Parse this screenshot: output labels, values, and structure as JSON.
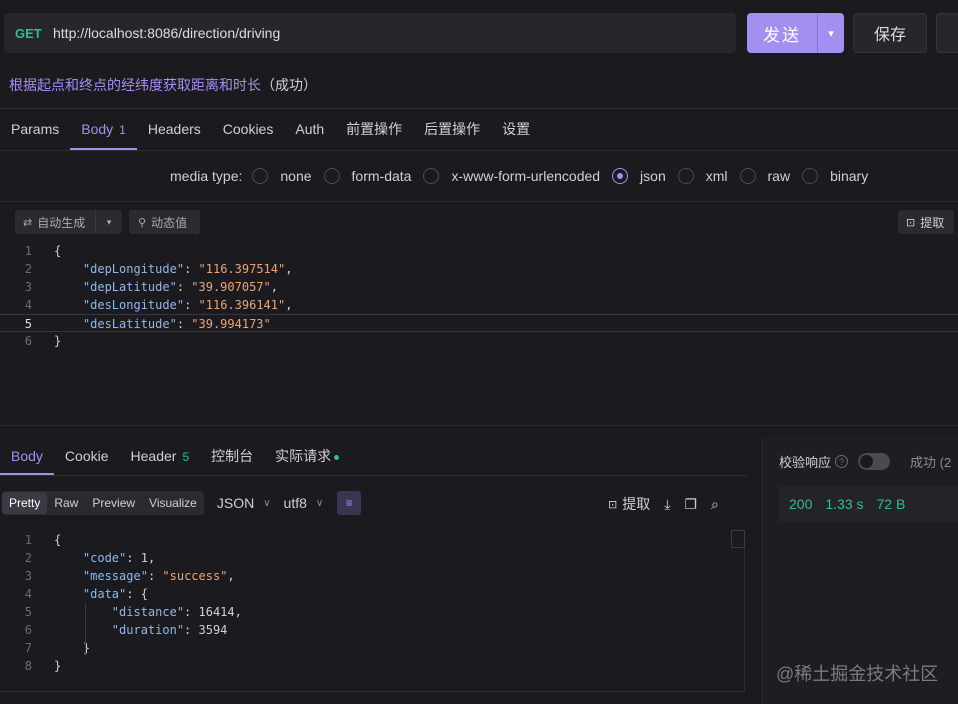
{
  "request": {
    "method": "GET",
    "url": "http://localhost:8086/direction/driving",
    "send_label": "发送",
    "save_label": "保存",
    "description": "根据起点和终点的经纬度获取距离和时长",
    "status_label": "（成功）"
  },
  "request_tabs": [
    {
      "label": "Params"
    },
    {
      "label": "Body",
      "count": "1"
    },
    {
      "label": "Headers"
    },
    {
      "label": "Cookies"
    },
    {
      "label": "Auth"
    },
    {
      "label": "前置操作"
    },
    {
      "label": "后置操作"
    },
    {
      "label": "设置"
    }
  ],
  "media": {
    "label": "media type:",
    "options": [
      "none",
      "form-data",
      "x-www-form-urlencoded",
      "json",
      "xml",
      "raw",
      "binary"
    ],
    "selected": "json"
  },
  "editor_toolbar": {
    "auto_generate": "自动生成",
    "dynamic_value": "动态值",
    "extract": "提取"
  },
  "request_body": [
    {
      "n": "1",
      "parts": [
        [
          "n",
          "{"
        ]
      ]
    },
    {
      "n": "2",
      "parts": [
        [
          "n",
          "    "
        ],
        [
          "k",
          "\"depLongitude\""
        ],
        [
          "n",
          ": "
        ],
        [
          "s",
          "\"116.397514\""
        ],
        [
          "n",
          ","
        ]
      ]
    },
    {
      "n": "3",
      "parts": [
        [
          "n",
          "    "
        ],
        [
          "k",
          "\"depLatitude\""
        ],
        [
          "n",
          ": "
        ],
        [
          "s",
          "\"39.907057\""
        ],
        [
          "n",
          ","
        ]
      ]
    },
    {
      "n": "4",
      "parts": [
        [
          "n",
          "    "
        ],
        [
          "k",
          "\"desLongitude\""
        ],
        [
          "n",
          ": "
        ],
        [
          "s",
          "\"116.396141\""
        ],
        [
          "n",
          ","
        ]
      ]
    },
    {
      "n": "5",
      "parts": [
        [
          "n",
          "    "
        ],
        [
          "k",
          "\"desLatitude\""
        ],
        [
          "n",
          ": "
        ],
        [
          "s",
          "\"39.994173\""
        ]
      ],
      "current": true
    },
    {
      "n": "6",
      "parts": [
        [
          "n",
          "}"
        ]
      ]
    }
  ],
  "response_tabs": [
    {
      "label": "Body",
      "active": true
    },
    {
      "label": "Cookie"
    },
    {
      "label": "Header",
      "count": "5"
    },
    {
      "label": "控制台"
    },
    {
      "label": "实际请求",
      "dot": true
    }
  ],
  "response_toolbar": {
    "views": [
      "Pretty",
      "Raw",
      "Preview",
      "Visualize"
    ],
    "active_view": "Pretty",
    "format": "JSON",
    "encoding": "utf8",
    "extract": "提取"
  },
  "response_meta": {
    "verify_label": "校验响应",
    "result": "成功 (2",
    "status_code": "200",
    "time": "1.33 s",
    "size": "72 B"
  },
  "response_body": [
    {
      "n": "1",
      "parts": [
        [
          "n",
          "{"
        ]
      ]
    },
    {
      "n": "2",
      "parts": [
        [
          "n",
          "    "
        ],
        [
          "k",
          "\"code\""
        ],
        [
          "n",
          ": 1,"
        ]
      ]
    },
    {
      "n": "3",
      "parts": [
        [
          "n",
          "    "
        ],
        [
          "k",
          "\"message\""
        ],
        [
          "n",
          ": "
        ],
        [
          "s",
          "\"success\""
        ],
        [
          "n",
          ","
        ]
      ]
    },
    {
      "n": "4",
      "parts": [
        [
          "n",
          "    "
        ],
        [
          "k",
          "\"data\""
        ],
        [
          "n",
          ": {"
        ]
      ]
    },
    {
      "n": "5",
      "parts": [
        [
          "n",
          "        "
        ],
        [
          "k",
          "\"distance\""
        ],
        [
          "n",
          ": 16414,"
        ]
      ]
    },
    {
      "n": "6",
      "parts": [
        [
          "n",
          "        "
        ],
        [
          "k",
          "\"duration\""
        ],
        [
          "n",
          ": 3594"
        ]
      ]
    },
    {
      "n": "7",
      "parts": [
        [
          "n",
          "    }"
        ]
      ]
    },
    {
      "n": "8",
      "parts": [
        [
          "n",
          "}"
        ]
      ]
    }
  ],
  "watermark": "@稀土掘金技术社区",
  "colors": {
    "accent": "#a48ef0",
    "method_get": "#2fbf8e",
    "json_key": "#8fb8e8",
    "json_string": "#e8a57a",
    "success": "#2fbf8e"
  }
}
